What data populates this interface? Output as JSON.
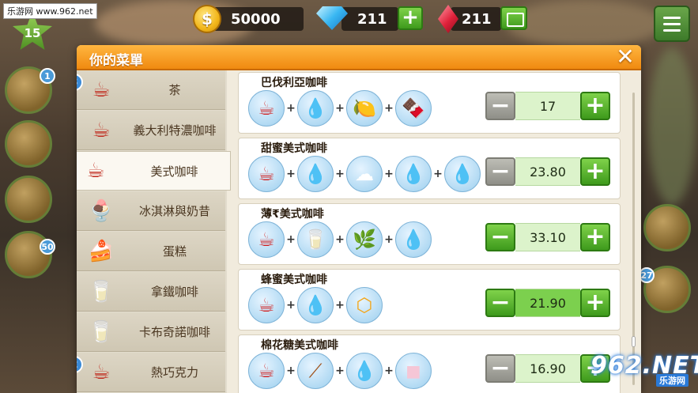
{
  "watermark": {
    "site_label": "乐游网 www.962.net",
    "brand_big": "962.NET",
    "brand_small": "乐游网"
  },
  "hud": {
    "level": "15",
    "coins": "50000",
    "coin_symbol": "$",
    "gems": "211",
    "rubies": "211",
    "side_badges": {
      "book": "1",
      "gift": "50",
      "right_cafe": "27"
    }
  },
  "dialog": {
    "title": "你的菜單",
    "close_symbol": "✕"
  },
  "categories": [
    {
      "label": "茶",
      "icon": "tea-cup-icon",
      "badge": "3",
      "selected": false
    },
    {
      "label": "義大利特濃咖啡",
      "icon": "espresso-cup-icon",
      "badge": "",
      "selected": false
    },
    {
      "label": "美式咖啡",
      "icon": "americano-cup-icon",
      "badge": "",
      "selected": true
    },
    {
      "label": "冰淇淋與奶昔",
      "icon": "ice-cream-icon",
      "badge": "",
      "selected": false
    },
    {
      "label": "蛋糕",
      "icon": "cake-icon",
      "badge": "",
      "selected": false
    },
    {
      "label": "拿鐵咖啡",
      "icon": "latte-glass-icon",
      "badge": "",
      "selected": false
    },
    {
      "label": "卡布奇諾咖啡",
      "icon": "cappuccino-glass-icon",
      "badge": "",
      "selected": false
    },
    {
      "label": "熱巧克力",
      "icon": "hot-chocolate-icon",
      "badge": "2",
      "selected": false
    }
  ],
  "recipes": [
    {
      "name": "巴伐利亞咖啡",
      "ingredients": [
        "red-coffee-cup-icon",
        "coffee-drop-icon",
        "lemon-slices-icon",
        "chocolate-bar-icon"
      ],
      "price": "17",
      "minus_enabled": false,
      "highlight": false
    },
    {
      "name": "甜蜜美式咖啡",
      "ingredients": [
        "red-coffee-cup-icon",
        "coffee-drop-icon",
        "whipped-cream-icon",
        "caramel-drop-icon",
        "syrup-drop-icon"
      ],
      "price": "23.80",
      "minus_enabled": false,
      "highlight": false
    },
    {
      "name": "薄₹美式咖啡",
      "ingredients": [
        "red-coffee-cup-icon",
        "milk-jug-icon",
        "mint-leaves-icon",
        "syrup-drop-icon"
      ],
      "price": "33.10",
      "minus_enabled": true,
      "highlight": false
    },
    {
      "name": "蜂蜜美式咖啡",
      "ingredients": [
        "red-coffee-cup-icon",
        "coffee-drop-icon",
        "honeycomb-icon"
      ],
      "price": "21.90",
      "minus_enabled": true,
      "highlight": true
    },
    {
      "name": "棉花糖美式咖啡",
      "ingredients": [
        "red-coffee-cup-icon",
        "cinnamon-sticks-icon",
        "caramel-drop-icon",
        "marshmallow-icon"
      ],
      "price": "16.90",
      "minus_enabled": false,
      "highlight": false
    }
  ],
  "buttons": {
    "plus": "+",
    "minus": "−",
    "sep": "+"
  }
}
